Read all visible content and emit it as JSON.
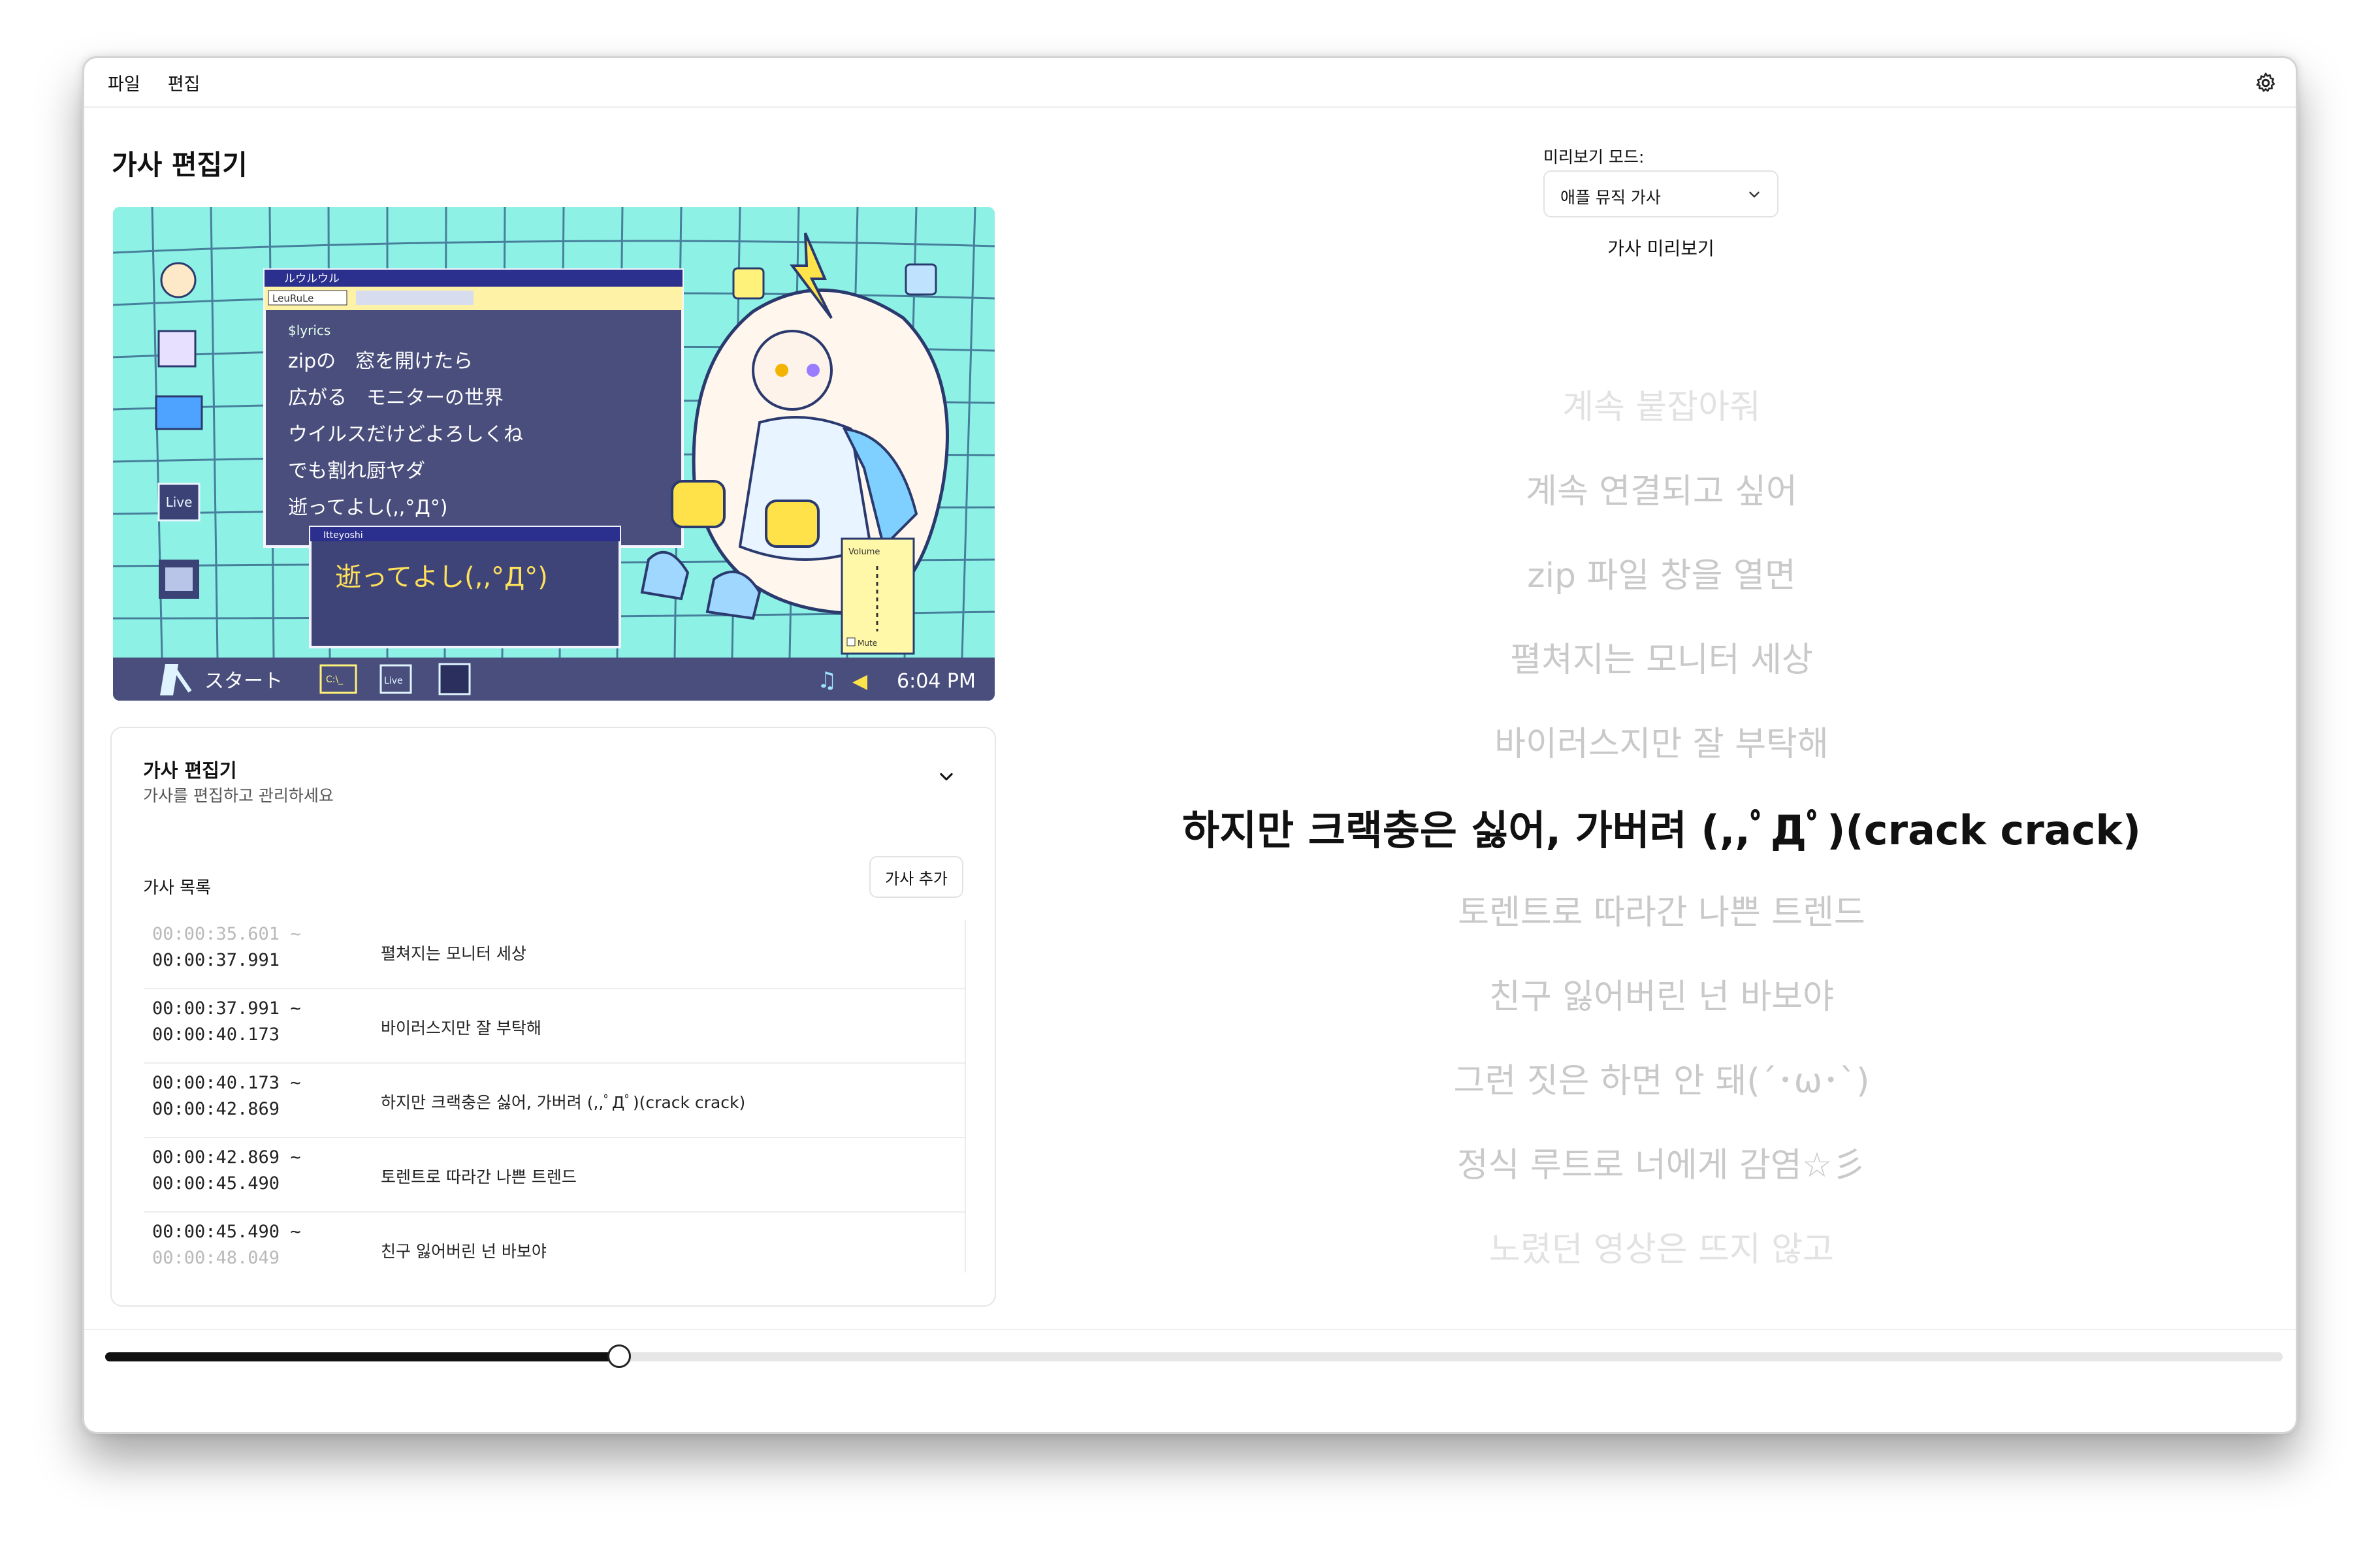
{
  "menu": {
    "items": [
      "파일",
      "편집"
    ]
  },
  "page_title": "가사 편집기",
  "video": {
    "window_title": "ルウルウル",
    "toolbar_field": "LeuRuLe",
    "prompt": "$lyrics",
    "lines": [
      "zipの　窓を開けたら",
      "広がる　モニターの世界",
      "ウイルスだけどよろしくね",
      "でも割れ厨ヤダ",
      "逝ってよし(,,°Д°)"
    ],
    "popup_title": "Itteyoshi",
    "popup_text": "逝ってよし(,,°Д°)",
    "start_label": "スタート",
    "desktop_icon_label": "Live",
    "taskbar_icons": [
      "C:\\_",
      "Live"
    ],
    "volume_label": "Volume",
    "mute_label": "Mute",
    "clock": "6:04 PM"
  },
  "editor": {
    "card_title": "가사 편집기",
    "card_subtitle": "가사를 편집하고 관리하세요",
    "list_title": "가사 목록",
    "add_button": "가사 추가",
    "rows": [
      {
        "start": "00:00:35.601 ~",
        "end": "00:00:37.991",
        "text": "펼쳐지는 모니터 세상"
      },
      {
        "start": "00:00:37.991 ~",
        "end": "00:00:40.173",
        "text": "바이러스지만 잘 부탁해"
      },
      {
        "start": "00:00:40.173 ~",
        "end": "00:00:42.869",
        "text": "하지만 크랙충은 싫어, 가버려 (,,ﾟДﾟ)(crack crack)"
      },
      {
        "start": "00:00:42.869 ~",
        "end": "00:00:45.490",
        "text": "토렌트로 따라간 나쁜 트렌드"
      },
      {
        "start": "00:00:45.490 ~",
        "end": "00:00:48.049",
        "text": "친구 잃어버린 넌 바보야"
      }
    ]
  },
  "preview": {
    "mode_label": "미리보기 모드:",
    "mode_value": "애플 뮤직 가사",
    "title": "가사 미리보기",
    "lyrics": [
      "계속 붙잡아줘",
      "계속 연결되고 싶어",
      "zip 파일 창을 열면",
      "펼쳐지는 모니터 세상",
      "바이러스지만 잘 부탁해",
      "하지만 크랙충은 싫어, 가버려 (,,ﾟДﾟ)(crack crack)",
      "토렌트로 따라간 나쁜 트렌드",
      "친구 잃어버린 넌 바보야",
      "그런 짓은 하면 안 돼(´･ω･`)",
      "정식 루트로 너에게 감염☆彡",
      "노렸던 영상은 뜨지 않고"
    ],
    "active_index": 5
  },
  "progress": {
    "fraction": 0.236
  }
}
